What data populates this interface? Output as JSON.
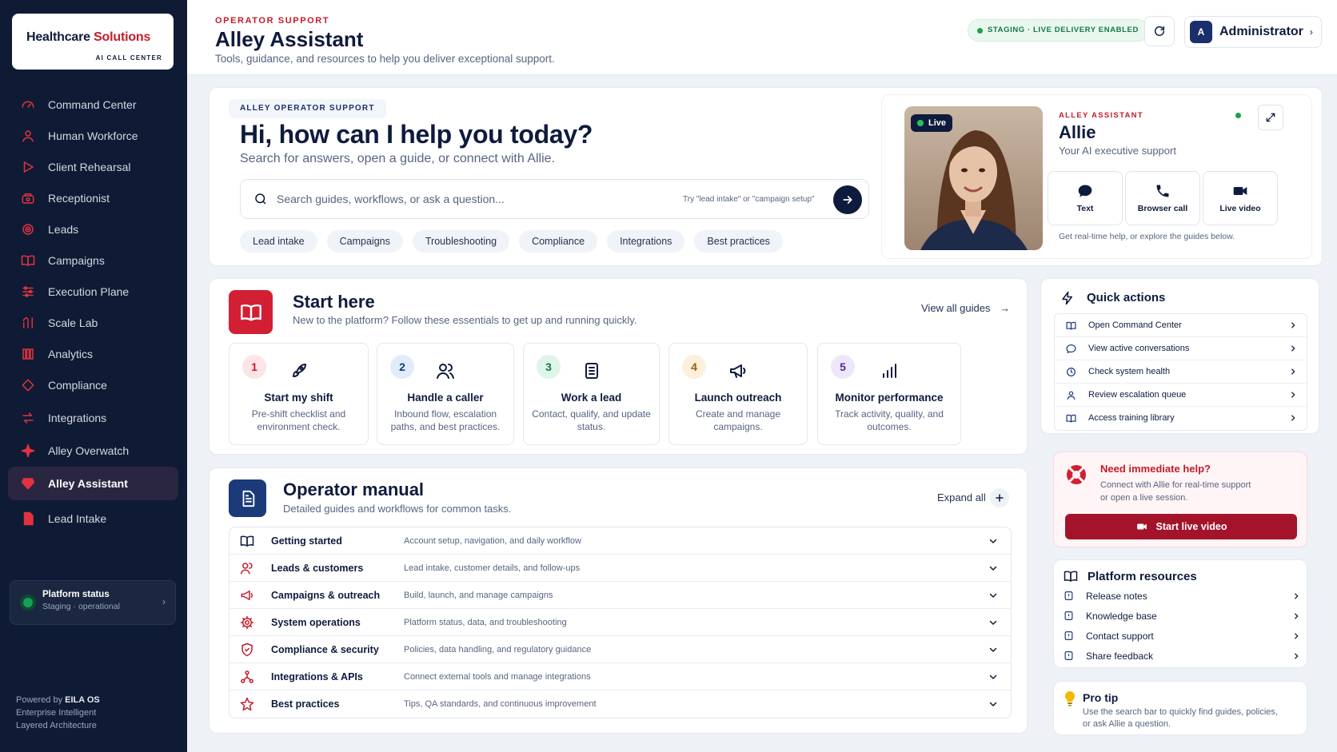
{
  "brand": {
    "name_part1": "Healthcare ",
    "name_part2": "Solutions",
    "sub": "AI CALL CENTER"
  },
  "nav": {
    "items": [
      {
        "label": "Command Center",
        "icon": "gauge-icon"
      },
      {
        "label": "Human Workforce",
        "icon": "user-icon"
      },
      {
        "label": "Client Rehearsal",
        "icon": "play-icon"
      },
      {
        "label": "Receptionist",
        "icon": "phone-icon"
      },
      {
        "label": "Leads",
        "icon": "target-icon"
      },
      {
        "label": "Campaigns",
        "icon": "book-icon"
      },
      {
        "label": "Execution Plane",
        "icon": "sliders-icon"
      },
      {
        "label": "Scale Lab",
        "icon": "growth-icon"
      },
      {
        "label": "Analytics",
        "icon": "columns-icon"
      },
      {
        "label": "Compliance",
        "icon": "diamond-icon"
      },
      {
        "label": "Integrations",
        "icon": "arrows-icon"
      },
      {
        "label": "Alley Overwatch",
        "icon": "sparkle-icon"
      },
      {
        "label": "Alley Assistant",
        "icon": "gem-icon"
      },
      {
        "label": "Lead Intake",
        "icon": "document-icon"
      }
    ],
    "active_index": 12
  },
  "platform_status": {
    "title": "Platform status",
    "sub": "Staging · operational"
  },
  "powered": {
    "prefix": "Powered by ",
    "brand": "EILA OS",
    "line2": "Enterprise Intelligent",
    "line3": "Layered Architecture"
  },
  "header": {
    "kicker": "OPERATOR SUPPORT",
    "title": "Alley Assistant",
    "subtitle": "Tools, guidance, and resources to help you deliver exceptional support.",
    "env_badge": "STAGING · LIVE DELIVERY ENABLED",
    "user_initial": "A",
    "user_name": "Administrator"
  },
  "hero": {
    "kicker": "ALLEY OPERATOR SUPPORT",
    "title": "Hi, how can I help you today?",
    "subtitle": "Search for answers, open a guide, or connect with Allie.",
    "search_placeholder": "Search guides, workflows, or ask a question...",
    "search_hint": "Try \"lead intake\" or \"campaign setup\"",
    "chips": [
      "Lead intake",
      "Campaigns",
      "Troubleshooting",
      "Compliance",
      "Integrations",
      "Best practices"
    ]
  },
  "allie": {
    "live": "Live",
    "kicker": "ALLEY ASSISTANT",
    "name": "Allie",
    "role": "Your AI executive support",
    "channels": [
      "Text",
      "Browser call",
      "Live video"
    ],
    "footer": "Get real-time help, or explore the guides below."
  },
  "start_here": {
    "title": "Start here",
    "subtitle": "New to the platform? Follow these essentials to get up and running quickly.",
    "link": "View all guides",
    "steps": [
      {
        "num": "1",
        "title": "Start my shift",
        "desc": "Pre-shift checklist and environment check.",
        "color": "#fde4e6",
        "num_color": "#c51b2a"
      },
      {
        "num": "2",
        "title": "Handle a caller",
        "desc": "Inbound flow, escalation paths, and best practices.",
        "color": "#e1ecfb",
        "num_color": "#1a3a7a"
      },
      {
        "num": "3",
        "title": "Work a lead",
        "desc": "Contact, qualify, and update status.",
        "color": "#dff4ea",
        "num_color": "#137a45"
      },
      {
        "num": "4",
        "title": "Launch outreach",
        "desc": "Create and manage campaigns.",
        "color": "#fdf0dc",
        "num_color": "#a15c07"
      },
      {
        "num": "5",
        "title": "Monitor performance",
        "desc": "Track activity, quality, and outcomes.",
        "color": "#eee6fb",
        "num_color": "#5b2a9a"
      }
    ]
  },
  "manual": {
    "title": "Operator manual",
    "subtitle": "Detailed guides and workflows for common tasks.",
    "expand_label": "Expand all",
    "rows": [
      {
        "title": "Getting started",
        "desc": "Account setup, navigation, and daily workflow"
      },
      {
        "title": "Leads & customers",
        "desc": "Lead intake, customer details, and follow-ups"
      },
      {
        "title": "Campaigns & outreach",
        "desc": "Build, launch, and manage campaigns"
      },
      {
        "title": "System operations",
        "desc": "Platform status, data, and troubleshooting"
      },
      {
        "title": "Compliance & security",
        "desc": "Policies, data handling, and regulatory guidance"
      },
      {
        "title": "Integrations & APIs",
        "desc": "Connect external tools and manage integrations"
      },
      {
        "title": "Best practices",
        "desc": "Tips, QA standards, and continuous improvement"
      }
    ]
  },
  "quick_actions": {
    "title": "Quick actions",
    "items": [
      "Open Command Center",
      "View active conversations",
      "Check system health",
      "Review escalation queue",
      "Access training library"
    ]
  },
  "help": {
    "title": "Need immediate help?",
    "line1": "Connect with Allie for real-time support",
    "line2": "or open a live session.",
    "button": "Start live video"
  },
  "resources": {
    "title": "Platform resources",
    "items": [
      "Release notes",
      "Knowledge base",
      "Contact support",
      "Share feedback"
    ]
  },
  "tip": {
    "title": "Pro tip",
    "line1": "Use the search bar to quickly find guides, policies,",
    "line2": "or ask Allie a question."
  },
  "colors": {
    "brand_navy": "#0f1b3d",
    "accent_red": "#c51b2a",
    "sidebar_bg": "#0f1b35",
    "success": "#16a34a"
  }
}
